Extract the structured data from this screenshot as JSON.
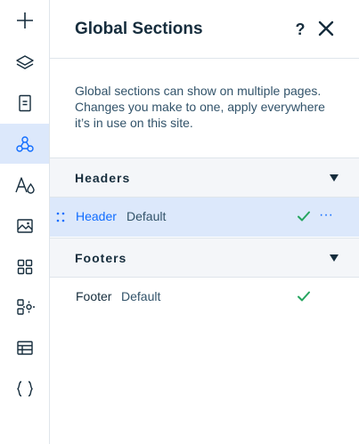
{
  "rail": {
    "items": [
      {
        "icon": "add-icon"
      },
      {
        "icon": "layers-icon"
      },
      {
        "icon": "pages-icon"
      },
      {
        "icon": "global-sections-icon",
        "active": true
      },
      {
        "icon": "theme-text-icon"
      },
      {
        "icon": "media-icon"
      },
      {
        "icon": "apps-icon"
      },
      {
        "icon": "business-tools-icon"
      },
      {
        "icon": "cms-table-icon"
      },
      {
        "icon": "code-icon"
      }
    ]
  },
  "panel": {
    "title": "Global Sections",
    "help_label": "?",
    "description": "Global sections can show on multiple pages. Changes you make to one, apply everywhere it’s in use on this site."
  },
  "groups": {
    "headers": {
      "title": "Headers",
      "items": [
        {
          "name": "Header",
          "variant": "Default",
          "selected": true,
          "more_label": "···"
        }
      ]
    },
    "footers": {
      "title": "Footers",
      "items": [
        {
          "name": "Footer",
          "variant": "Default",
          "selected": false
        }
      ]
    }
  },
  "colors": {
    "accent": "#116dff",
    "check": "#25a55f",
    "selected_bg": "#dce8fb",
    "group_bg": "#f4f6f9"
  }
}
